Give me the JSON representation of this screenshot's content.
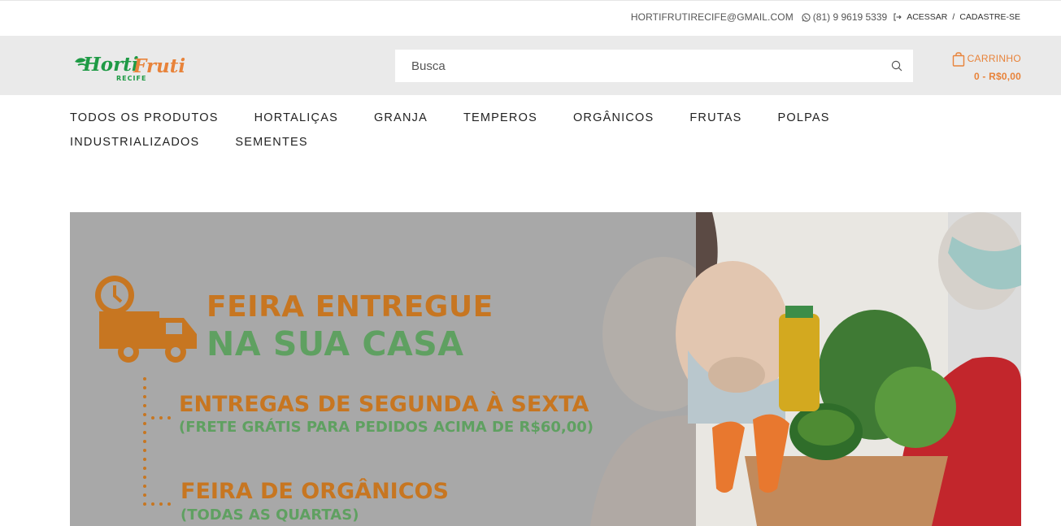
{
  "topbar": {
    "email": "HORTIFRUTIRECIFE@GMAIL.COM",
    "phone": "(81) 9 9619 5339",
    "login_label": "ACESSAR",
    "separator": "/",
    "signup_label": "CADASTRE-SE"
  },
  "header": {
    "logo": {
      "brand_primary": "Horti",
      "brand_secondary": "Fruti",
      "city": "RECIFE"
    },
    "search": {
      "placeholder": "Busca",
      "value": ""
    },
    "cart": {
      "label": "CARRINHO",
      "total": "0 - R$0,00"
    }
  },
  "nav": {
    "items": [
      {
        "label": "TODOS OS PRODUTOS"
      },
      {
        "label": "HORTALIÇAS"
      },
      {
        "label": "GRANJA"
      },
      {
        "label": "TEMPEROS"
      },
      {
        "label": "ORGÂNICOS"
      },
      {
        "label": "FRUTAS"
      },
      {
        "label": "POLPAS"
      },
      {
        "label": "INDUSTRIALIZADOS"
      },
      {
        "label": "SEMENTES"
      }
    ]
  },
  "banner": {
    "title_line1": "FEIRA ENTREGUE",
    "title_line2": "NA SUA CASA",
    "item1_title": "ENTREGAS DE SEGUNDA À SEXTA",
    "item1_sub": "(FRETE GRÁTIS PARA PEDIDOS ACIMA DE R$60,00)",
    "item2_title": "FEIRA DE ORGÂNICOS",
    "item2_sub": "(TODAS AS QUARTAS)"
  },
  "colors": {
    "accent_orange": "#e8833a",
    "banner_orange": "#c77621",
    "banner_green": "#5fa061",
    "logo_green": "#1e9a45",
    "header_bg": "#eaeaea"
  },
  "icons": {
    "phone": "whatsapp-icon",
    "login": "login-arrow-icon",
    "search": "search-icon",
    "cart": "shopping-bag-icon",
    "delivery": "delivery-truck-clock-icon"
  }
}
